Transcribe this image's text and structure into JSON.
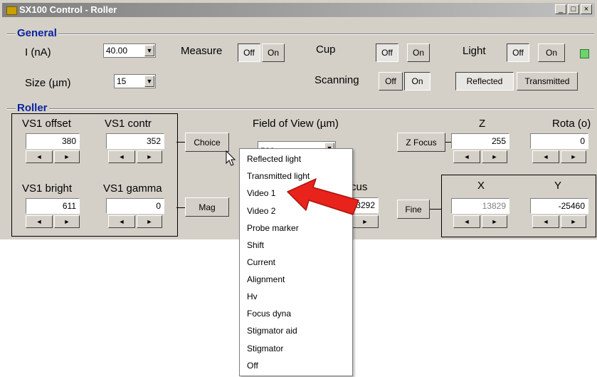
{
  "titlebar": {
    "title": "SX100 Control - Roller",
    "minimize": "_",
    "maximize": "□",
    "close": "×"
  },
  "general": {
    "group_title": "General",
    "current_label": "I (nA)",
    "current_value": "40.00",
    "size_label": "Size (µm)",
    "size_value": "15",
    "measure_label": "Measure",
    "measure_off": "Off",
    "measure_on": "On",
    "cup_label": "Cup",
    "cup_off": "Off",
    "cup_on": "On",
    "scanning_label": "Scanning",
    "scanning_off": "Off",
    "scanning_on": "On",
    "light_label": "Light",
    "light_off": "Off",
    "light_on": "On",
    "reflected": "Reflected",
    "transmitted": "Transmitted"
  },
  "roller": {
    "group_title": "Roller",
    "vs1_offset_label": "VS1 offset",
    "vs1_offset_value": "380",
    "vs1_contr_label": "VS1 contr",
    "vs1_contr_value": "352",
    "vs1_bright_label": "VS1 bright",
    "vs1_bright_value": "611",
    "vs1_gamma_label": "VS1 gamma",
    "vs1_gamma_value": "0",
    "choice_button": "Choice",
    "mag_button": "Mag",
    "fov_label": "Field of View (µm)",
    "fov_value": "582",
    "focus_label_partial": "cus",
    "focus_value_partial": "3292",
    "z_focus_button": "Z Focus",
    "z_label": "Z",
    "z_value": "255",
    "rota_label": "Rota (o)",
    "rota_value": "0",
    "fine_button": "Fine",
    "x_label": "X",
    "x_value": "13829",
    "y_label": "Y",
    "y_value": "-25460",
    "spin_left": "◄",
    "spin_right": "►"
  },
  "menu": {
    "items": [
      "Reflected light",
      "Transmitted light",
      "Video 1",
      "Video 2",
      "Probe marker",
      "Shift",
      "Current",
      "Alignment",
      "Hv",
      "Focus dyna",
      "Stigmator aid",
      "Stigmator",
      "Off"
    ]
  },
  "colors": {
    "group_title": "#0a24a0",
    "indicator": "#6fd36f",
    "arrow": "#e8231c"
  }
}
